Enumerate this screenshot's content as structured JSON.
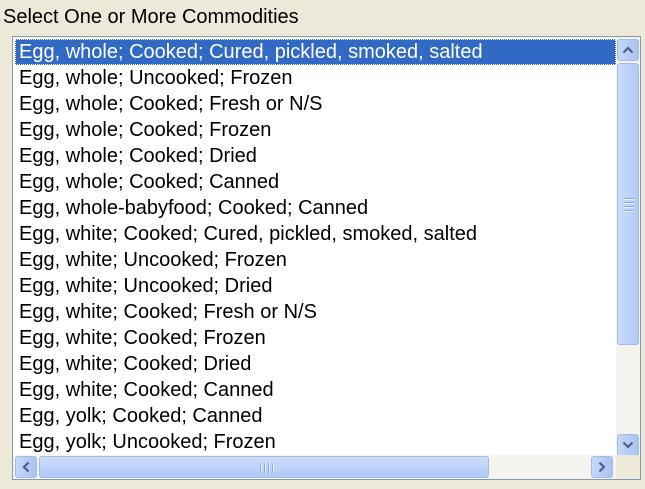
{
  "label": "Select One or More Commodities",
  "commodities": [
    "Egg, whole; Cooked; Cured, pickled, smoked, salted",
    "Egg, whole; Uncooked; Frozen",
    "Egg, whole; Cooked; Fresh or N/S",
    "Egg, whole; Cooked; Frozen",
    "Egg, whole; Cooked; Dried",
    "Egg, whole; Cooked; Canned",
    "Egg, whole-babyfood; Cooked; Canned",
    "Egg, white; Cooked; Cured, pickled, smoked, salted",
    "Egg, white; Uncooked; Frozen",
    "Egg, white; Uncooked; Dried",
    "Egg, white; Cooked; Fresh or N/S",
    "Egg, white; Cooked; Frozen",
    "Egg, white; Cooked; Dried",
    "Egg, white; Cooked; Canned",
    "Egg, yolk; Cooked; Canned",
    "Egg, yolk; Uncooked; Frozen"
  ],
  "selected_index": 0,
  "icons": {
    "scroll_up": "scroll-up-arrow-icon",
    "scroll_down": "scroll-down-arrow-icon",
    "scroll_left": "scroll-left-arrow-icon",
    "scroll_right": "scroll-right-arrow-icon"
  },
  "colors": {
    "selection": "#316ac5",
    "scrollbar": "#c1d3fb",
    "window": "#ece9d8"
  }
}
